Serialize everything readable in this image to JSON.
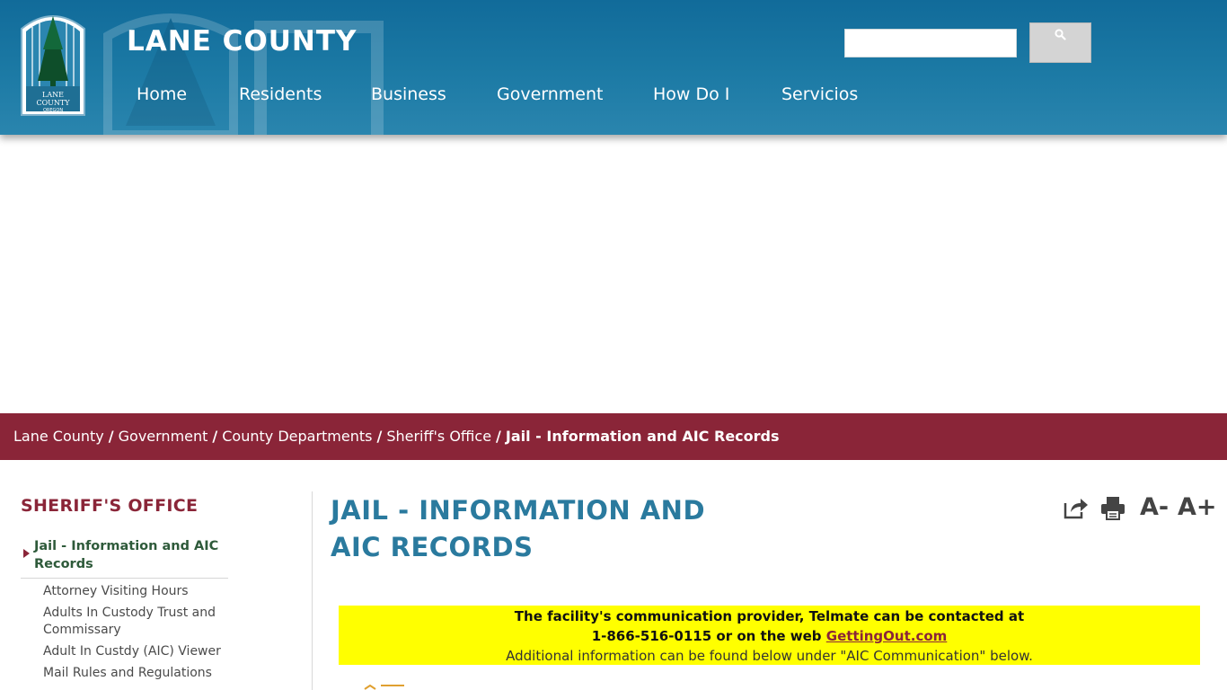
{
  "header": {
    "site_title": "LANE COUNTY",
    "logo_text": [
      "LANE",
      "COUNTY",
      "OREGON"
    ],
    "search": {
      "placeholder": ""
    },
    "nav": [
      "Home",
      "Residents",
      "Business",
      "Government",
      "How Do I",
      "Servicios"
    ]
  },
  "breadcrumb": {
    "items": [
      "Lane County",
      "Government",
      "County Departments",
      "Sheriff's Office"
    ],
    "current": "Jail - Information and AIC Records"
  },
  "sidebar": {
    "title": "SHERIFF'S OFFICE",
    "active": "Jail - Information and AIC Records",
    "links": [
      "Attorney Visiting Hours",
      "Adults In Custody Trust and Commissary",
      "Adult In Custdy (AIC) Viewer",
      "Mail Rules and Regulations"
    ]
  },
  "main": {
    "title": "JAIL - INFORMATION AND AIC RECORDS",
    "tools": {
      "font_decrease": "A-",
      "font_increase": "A+"
    },
    "notice": {
      "line1": "The facility's communication provider, Telmate can be contacted at",
      "line2_prefix": "1-866-516-0115 or on the web",
      "link": "GettingOut.com",
      "line3": "Additional information can be found below under \"AIC Communication\" below."
    }
  },
  "colors": {
    "header_blue": "#1c7aa5",
    "breadcrumb_maroon": "#8a2538",
    "title_blue": "#2a7a9e",
    "notice_yellow": "#ffff00"
  }
}
